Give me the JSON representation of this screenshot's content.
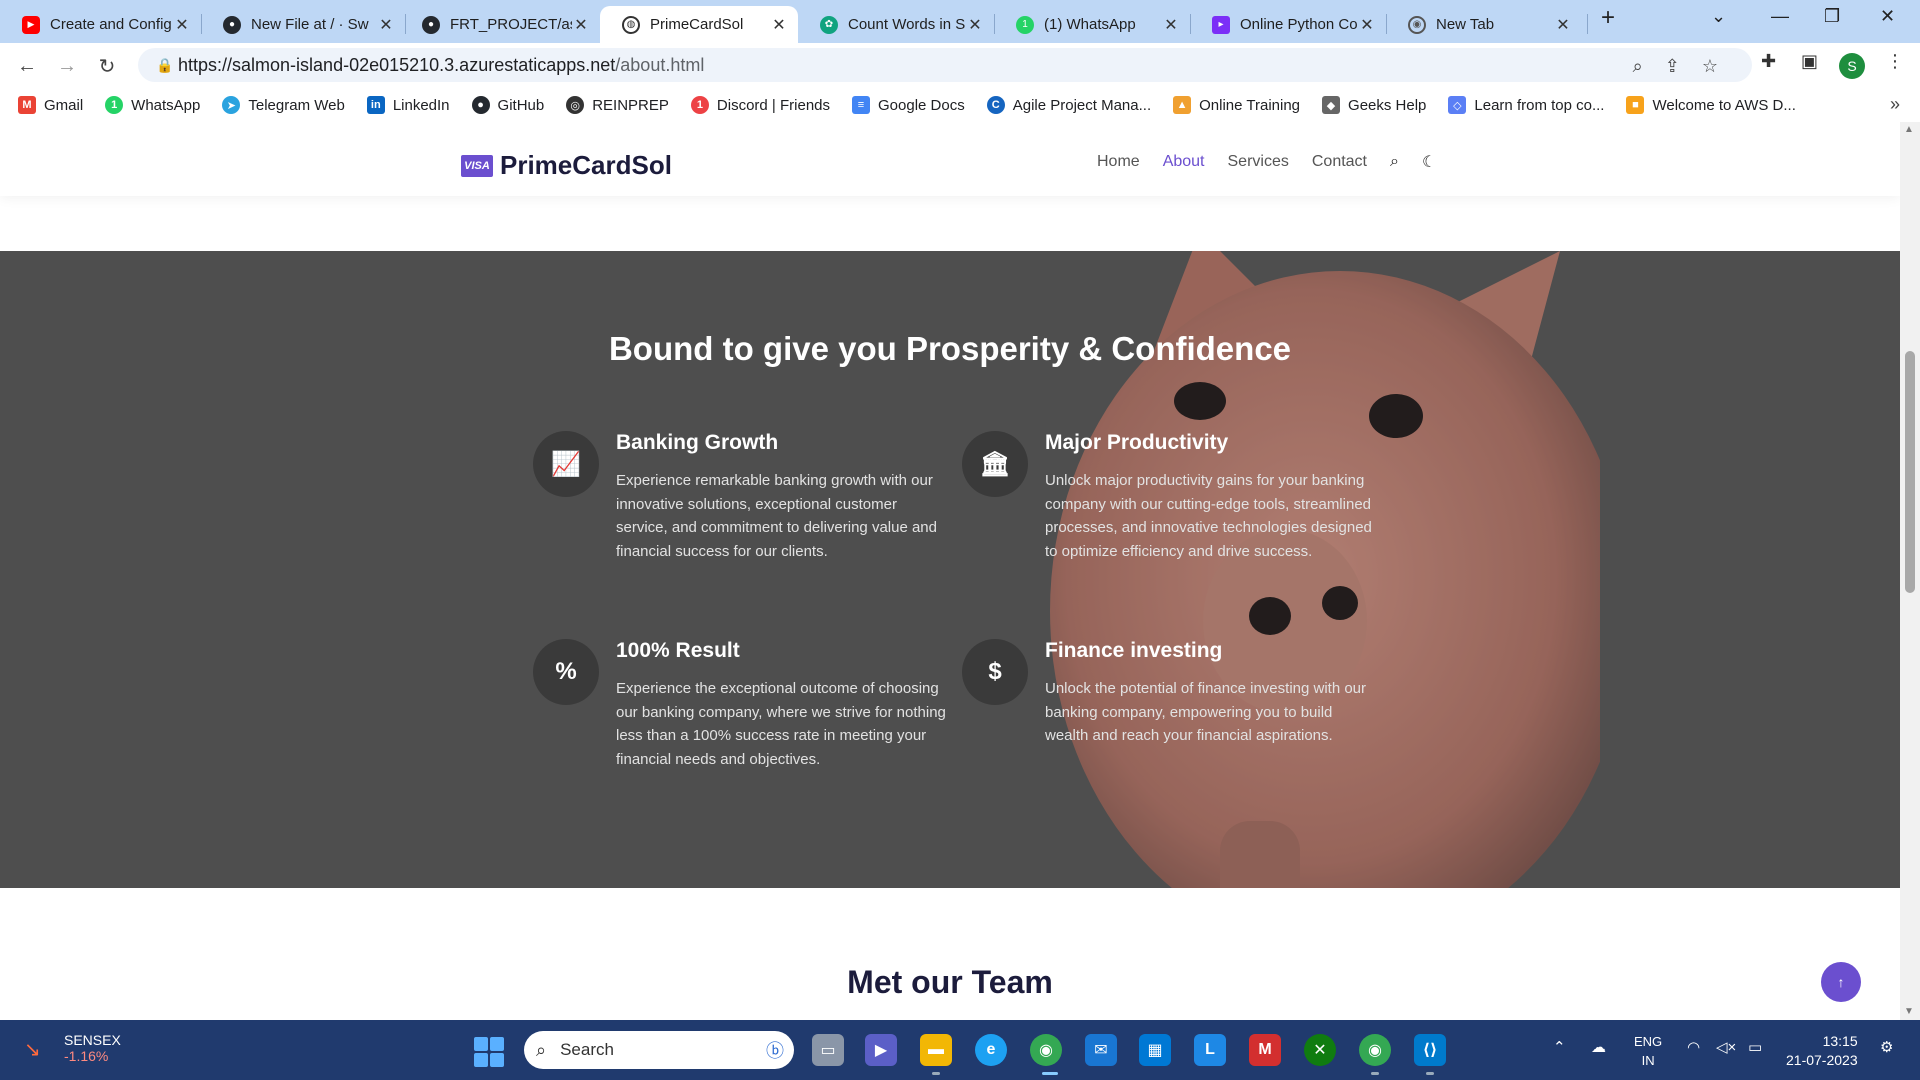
{
  "browser": {
    "tabs": [
      {
        "title": "Create and Config",
        "icon": "youtube-icon",
        "color": "#ff0000"
      },
      {
        "title": "New File at / · Sw",
        "icon": "github-icon",
        "color": "#24292f"
      },
      {
        "title": "FRT_PROJECT/ass",
        "icon": "github-icon",
        "color": "#24292f"
      },
      {
        "title": "PrimeCardSol",
        "icon": "globe-icon",
        "color": "#333333"
      },
      {
        "title": "Count Words in S",
        "icon": "openai-icon",
        "color": "#10a37f"
      },
      {
        "title": "(1) WhatsApp",
        "icon": "whatsapp-icon",
        "color": "#25d366"
      },
      {
        "title": "Online Python Co",
        "icon": "replit-icon",
        "color": "#7b2ff7"
      },
      {
        "title": "New Tab",
        "icon": "chrome-icon",
        "color": "#555555"
      }
    ],
    "url_host": "https://salmon-island-02e015210.3.azurestaticapps.net",
    "url_path": "/about.html",
    "profile_initial": "S",
    "bookmarks": [
      {
        "label": "Gmail",
        "color": "#ea4335",
        "glyph": "M"
      },
      {
        "label": "WhatsApp",
        "color": "#25d366",
        "glyph": "1"
      },
      {
        "label": "Telegram Web",
        "color": "#2aa3df",
        "glyph": "➤"
      },
      {
        "label": "LinkedIn",
        "color": "#0a66c2",
        "glyph": "in"
      },
      {
        "label": "GitHub",
        "color": "#24292f",
        "glyph": "●"
      },
      {
        "label": "REINPREP",
        "color": "#333333",
        "glyph": "◎"
      },
      {
        "label": "Discord | Friends",
        "color": "#ed4245",
        "glyph": "1"
      },
      {
        "label": "Google Docs",
        "color": "#4285f4",
        "glyph": "≡"
      },
      {
        "label": "Agile Project Mana...",
        "color": "#1565c0",
        "glyph": "C"
      },
      {
        "label": "Online Training",
        "color": "#f0a030",
        "glyph": "▲"
      },
      {
        "label": "Geeks Help",
        "color": "#666666",
        "glyph": "◆"
      },
      {
        "label": "Learn from top co...",
        "color": "#5b7ff5",
        "glyph": "◇"
      },
      {
        "label": "Welcome to AWS D...",
        "color": "#f7a21b",
        "glyph": "■"
      }
    ]
  },
  "site": {
    "brand_badge": "VISA",
    "brand_name": "PrimeCardSol",
    "nav": {
      "home": "Home",
      "about": "About",
      "services": "Services",
      "contact": "Contact"
    },
    "hero_title": "Bound to give you Prosperity & Confidence",
    "features": [
      {
        "title": "Banking Growth",
        "glyph": "📈",
        "icon": "chart-line-icon",
        "text": "Experience remarkable banking growth with our innovative solutions, exceptional customer service, and commitment to delivering value and financial success for our clients."
      },
      {
        "title": "Major Productivity",
        "glyph": "🏛",
        "icon": "bank-icon",
        "text": "Unlock major productivity gains for your banking company with our cutting-edge tools, streamlined processes, and innovative technologies designed to optimize efficiency and drive success."
      },
      {
        "title": "100% Result",
        "glyph": "%",
        "icon": "percent-icon",
        "text": "Experience the exceptional outcome of choosing our banking company, where we strive for nothing less than a 100% success rate in meeting your financial needs and objectives."
      },
      {
        "title": "Finance investing",
        "glyph": "$",
        "icon": "dollar-icon",
        "text": "Unlock the potential of finance investing with our banking company, empowering you to build wealth and reach your financial aspirations."
      }
    ],
    "team_title": "Met our Team"
  },
  "taskbar": {
    "stock_name": "SENSEX",
    "stock_change": "-1.16%",
    "search_placeholder": "Search",
    "lang_top": "ENG",
    "lang_bottom": "IN",
    "time": "13:15",
    "date": "21-07-2023"
  },
  "colors": {
    "accent": "#6b4fcf",
    "hero_bg": "#545454",
    "tabstrip": "#bed7f5",
    "taskbar": "#203a6e"
  }
}
